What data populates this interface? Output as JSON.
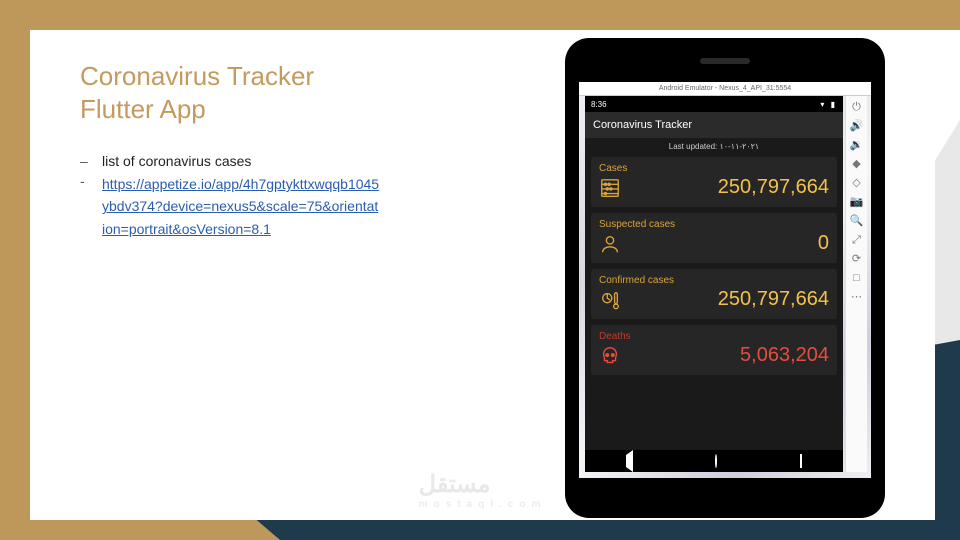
{
  "slide": {
    "title": "Coronavirus Tracker Flutter App",
    "bullet1": "list of coronavirus cases",
    "bullet2_link": "https://appetize.io/app/4h7gptykttxwqqb1045ybdv374?device=nexus5&scale=75&orientation=portrait&osVersion=8.1"
  },
  "emulator": {
    "title": "Android Emulator - Nexus_4_API_31:5554",
    "status_time": "8:36",
    "appbar": "Coronavirus Tracker",
    "last_updated": "Last updated: ٢٠٢١-١١-١٠",
    "cards": [
      {
        "label": "Cases",
        "value": "250,797,664",
        "tone": "y",
        "icon": "abacus"
      },
      {
        "label": "Suspected cases",
        "value": "0",
        "tone": "y",
        "icon": "person"
      },
      {
        "label": "Confirmed cases",
        "value": "250,797,664",
        "tone": "y",
        "icon": "thermo"
      },
      {
        "label": "Deaths",
        "value": "5,063,204",
        "tone": "r",
        "icon": "skull"
      }
    ],
    "side_icons": [
      "⏻",
      "🔊",
      "🔉",
      "◆",
      "◇",
      "📷",
      "🔍",
      "⤢",
      "⟳",
      "□",
      "⋯"
    ]
  },
  "watermark": {
    "ar": "مستقل",
    "en": "mostaql.com"
  }
}
